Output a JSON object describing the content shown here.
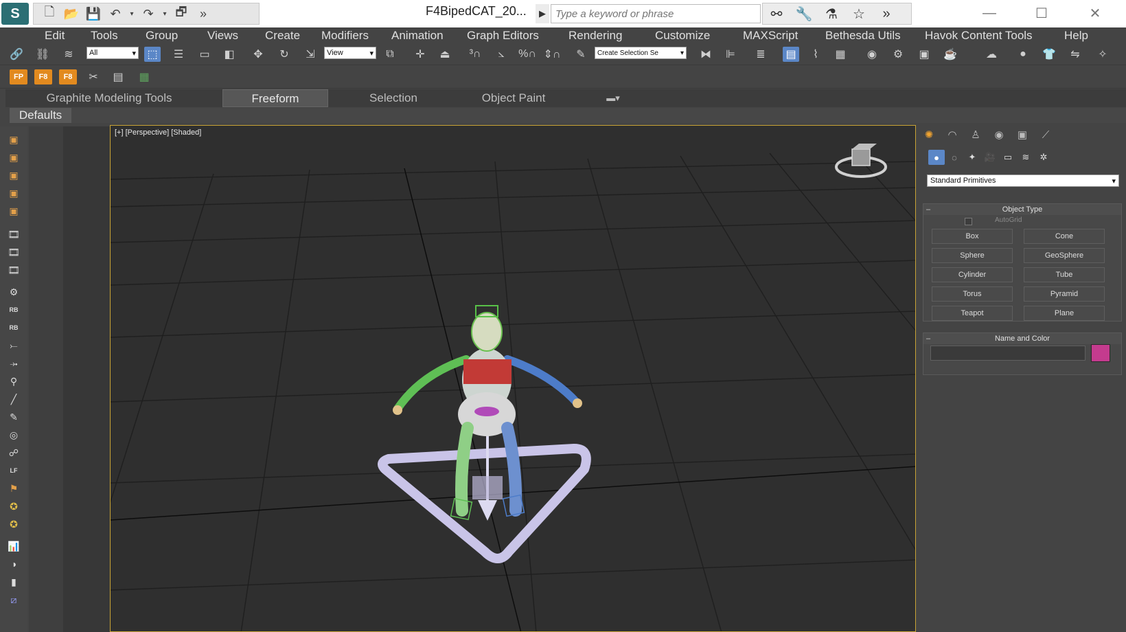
{
  "window": {
    "app_logo": "S",
    "title": "F4BipedCAT_20...",
    "search_placeholder": "Type a keyword or phrase",
    "minimize": "—",
    "maximize": "☐",
    "close": "✕"
  },
  "menu": [
    "Edit",
    "Tools",
    "Group",
    "Views",
    "Create",
    "Modifiers",
    "Animation",
    "Graph Editors",
    "Rendering",
    "Customize",
    "MAXScript",
    "Bethesda Utils",
    "Havok Content Tools",
    "Help"
  ],
  "toolbar": {
    "selection_filter": "All",
    "ref_coord": "View",
    "named_selection": "Create Selection Se"
  },
  "subtoolbar": {
    "tiles": [
      "FP",
      "F8",
      "F8"
    ]
  },
  "ribbon": {
    "tabs": [
      "Graphite Modeling Tools",
      "Freeform",
      "Selection",
      "Object Paint"
    ],
    "active_tab": "Freeform",
    "panel": "Defaults"
  },
  "viewport": {
    "label": "[+] [Perspective] [Shaded]"
  },
  "command_panel": {
    "category": "Standard Primitives",
    "object_type": {
      "title": "Object Type",
      "autogrid": "AutoGrid",
      "buttons": [
        "Box",
        "Cone",
        "Sphere",
        "GeoSphere",
        "Cylinder",
        "Tube",
        "Torus",
        "Pyramid",
        "Teapot",
        "Plane"
      ]
    },
    "name_and_color": {
      "title": "Name and Color",
      "color": "#c43b8e"
    },
    "collapse_symbol": "–"
  },
  "colors": {
    "viewport_border": "#c9a435",
    "active_blue": "#5b87c7",
    "create_tab": "#f0a330"
  }
}
